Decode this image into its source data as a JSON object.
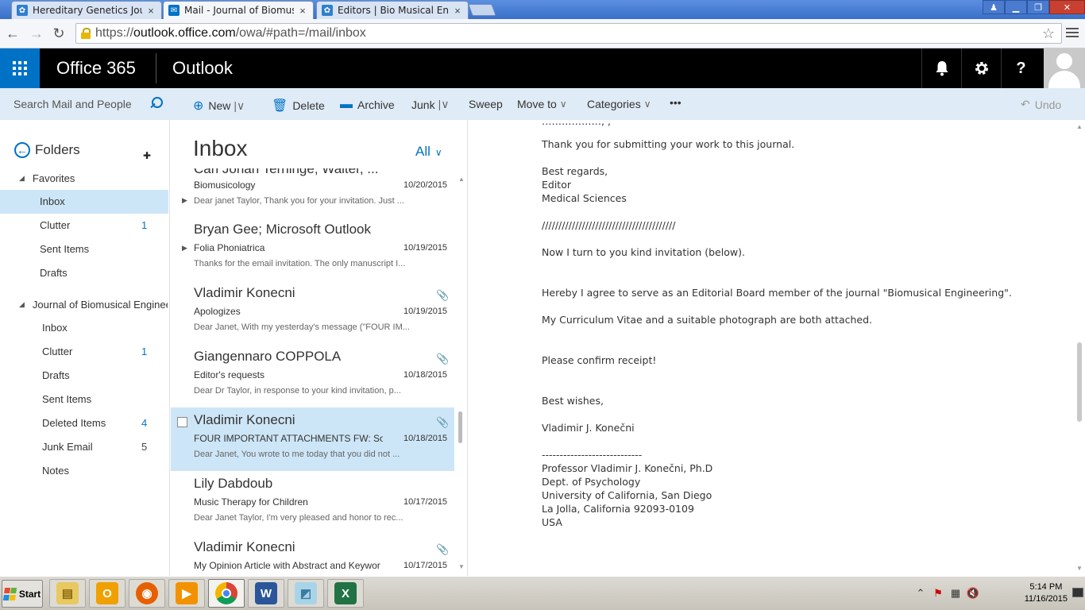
{
  "browser": {
    "tabs": [
      {
        "label": "Hereditary Genetics Journal",
        "active": false,
        "icon": "journal-icon",
        "close": "×"
      },
      {
        "label": "Mail - Journal of Biomusical",
        "active": true,
        "icon": "mail-icon",
        "close": "×"
      },
      {
        "label": "Editors | Bio Musical Engine",
        "active": false,
        "icon": "journal-icon",
        "close": "×"
      }
    ],
    "url_scheme": "https://",
    "url_domain": "outlook.office.com",
    "url_path": "/owa/#path=/mail/inbox"
  },
  "header": {
    "brand": "Office 365",
    "app": "Outlook",
    "icons": {
      "bell": "bell-icon",
      "gear": "gear-icon",
      "help": "?"
    }
  },
  "commandbar": {
    "search_placeholder": "Search Mail and People",
    "new": "New",
    "delete": "Delete",
    "archive": "Archive",
    "junk": "Junk",
    "sweep": "Sweep",
    "move_to": "Move to",
    "categories": "Categories",
    "more": "•••",
    "undo": "Undo"
  },
  "folders": {
    "title": "Folders",
    "favorites_label": "Favorites",
    "favorites": [
      {
        "label": "Inbox",
        "count": "",
        "selected": true
      },
      {
        "label": "Clutter",
        "count": "1",
        "selected": false
      },
      {
        "label": "Sent Items",
        "count": "",
        "selected": false
      },
      {
        "label": "Drafts",
        "count": "",
        "selected": false
      }
    ],
    "account_label": "Journal of Biomusical Engineering",
    "account": [
      {
        "label": "Inbox",
        "count": ""
      },
      {
        "label": "Clutter",
        "count": "1"
      },
      {
        "label": "Drafts",
        "count": ""
      },
      {
        "label": "Sent Items",
        "count": ""
      },
      {
        "label": "Deleted Items",
        "count": "4"
      },
      {
        "label": "Junk Email",
        "count": "5"
      },
      {
        "label": "Notes",
        "count": ""
      }
    ]
  },
  "messagelist": {
    "title": "Inbox",
    "filter": "All",
    "partial_from": "Carl Johan Terninge; Walter, ...",
    "messages": [
      {
        "from": "",
        "subject": "Biomusicology",
        "date": "10/20/2015",
        "preview": "Dear janet Taylor, Thank you for your invitation. Just ...",
        "thread": true,
        "attach": false,
        "selected": false
      },
      {
        "from": "Bryan Gee; Microsoft Outlook",
        "subject": "Folia Phoniatrica",
        "date": "10/19/2015",
        "preview": "Thanks for the email invitation. The only manuscript I...",
        "thread": true,
        "attach": false,
        "selected": false
      },
      {
        "from": "Vladimir Konecni",
        "subject": "Apologizes",
        "date": "10/19/2015",
        "preview": "Dear Janet,  With my yesterday's message (\"FOUR IM...",
        "thread": false,
        "attach": true,
        "selected": false
      },
      {
        "from": "Giangennaro COPPOLA",
        "subject": "Editor's requests",
        "date": "10/18/2015",
        "preview": "Dear Dr Taylor,  in response to your kind invitation, p...",
        "thread": false,
        "attach": true,
        "selected": false
      },
      {
        "from": "Vladimir Konecni",
        "subject": "FOUR IMPORTANT ATTACHMENTS FW: Solicit",
        "date": "10/18/2015",
        "preview": "Dear Janet,  You wrote to me today that you did not ...",
        "thread": false,
        "attach": true,
        "selected": true
      },
      {
        "from": "Lily Dabdoub",
        "subject": "Music Therapy for Children",
        "date": "10/17/2015",
        "preview": "Dear Janet Taylor,  I'm very pleased and honor to rec...",
        "thread": false,
        "attach": false,
        "selected": false
      },
      {
        "from": "Vladimir Konecni",
        "subject": "My Opinion Article with Abstract and Keywor",
        "date": "10/17/2015",
        "preview": "",
        "thread": false,
        "attach": true,
        "selected": false
      }
    ]
  },
  "reading": {
    "lines": [
      "Thank you for submitting your work to this journal.",
      "Best regards,",
      "Editor",
      "Medical Sciences",
      "////////////////////////////////////////",
      "Now I turn to you kind invitation (below).",
      "Hereby I agree to serve as an Editorial Board member of the journal \"Biomusical Engineering\".",
      "My Curriculum Vitae and a suitable photograph are both attached.",
      "Please confirm receipt!",
      "Best wishes,",
      "Vladimir J. Konečni",
      "----------------------------",
      "Professor Vladimir J. Konečni, Ph.D",
      "Dept. of Psychology",
      "University of California, San Diego",
      "La Jolla, California 92093-0109",
      "USA"
    ]
  },
  "taskbar": {
    "start": "Start",
    "time": "5:14 PM",
    "date": "11/16/2015"
  }
}
